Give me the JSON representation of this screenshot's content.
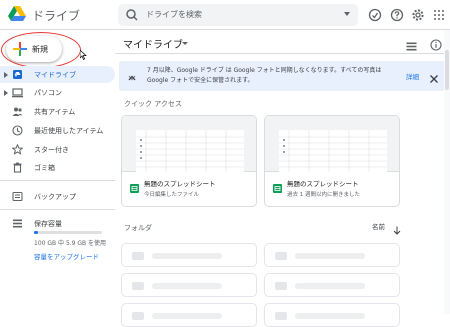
{
  "header": {
    "app_title": "ドライブ",
    "search_placeholder": "ドライブを検索",
    "icons": [
      "offline-status-icon",
      "help-icon",
      "settings-icon",
      "apps-grid-icon"
    ]
  },
  "sidebar": {
    "new_label": "新規",
    "items": [
      {
        "label": "マイドライブ",
        "icon": "my-drive-icon",
        "active": true
      },
      {
        "label": "パソコン",
        "icon": "computer-icon",
        "active": false
      },
      {
        "label": "共有アイテム",
        "icon": "shared-icon",
        "active": false
      },
      {
        "label": "最近使用したアイテム",
        "icon": "recent-icon",
        "active": false
      },
      {
        "label": "スター付き",
        "icon": "star-icon",
        "active": false
      },
      {
        "label": "ゴミ箱",
        "icon": "trash-icon",
        "active": false
      },
      {
        "label": "バックアップ",
        "icon": "backup-icon",
        "active": false
      },
      {
        "label": "保存容量",
        "icon": "storage-icon",
        "active": false
      }
    ],
    "storage_text": "100 GB 中 5.9 GB を使用",
    "storage_fraction": 0.059,
    "upgrade_label": "容量をアップグレード"
  },
  "main": {
    "title": "マイドライブ",
    "banner": {
      "text": "7 月以降、Google ドライブ は Google フォトと同期しなくなります。すべての写真は Google フォトで安全に保管されます。",
      "link": "詳細"
    },
    "quick_access_label": "クイック アクセス",
    "cards": [
      {
        "title": "無題のスプレッドシート",
        "subtitle": "今日編集したファイル"
      },
      {
        "title": "無題のスプレッドシート",
        "subtitle": "過去 1 週間以内に開きました"
      }
    ],
    "folders_label": "フォルダ",
    "sort_label": "名前"
  },
  "colors": {
    "accent": "#1a73e8",
    "active_bg": "#e8f0fe",
    "highlight_circle": "#e53935",
    "sheets_green": "#0f9d58"
  }
}
